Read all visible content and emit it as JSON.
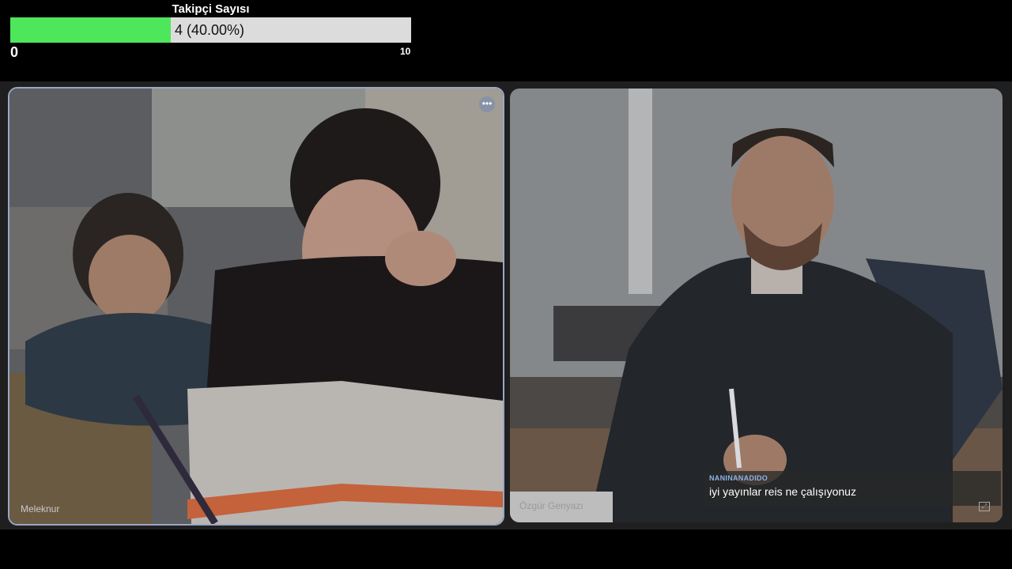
{
  "goal": {
    "title": "Takipçi Sayısı",
    "value_text": "4 (40.00%)",
    "progress": 0.4,
    "min_label": "0",
    "max_label": "10",
    "fill_color": "#4ee75b"
  },
  "participants": {
    "left": {
      "name": "Meleknur",
      "more_icon": "more-horizontal-icon",
      "highlight_color": "#9aa6c4"
    },
    "right": {
      "name": "Özgür Genyazı",
      "expand_icon": "expand-icon"
    }
  },
  "chat": {
    "username": "NANINANADIDO",
    "message": "iyi yayınlar reis ne çalışıyonuz"
  }
}
